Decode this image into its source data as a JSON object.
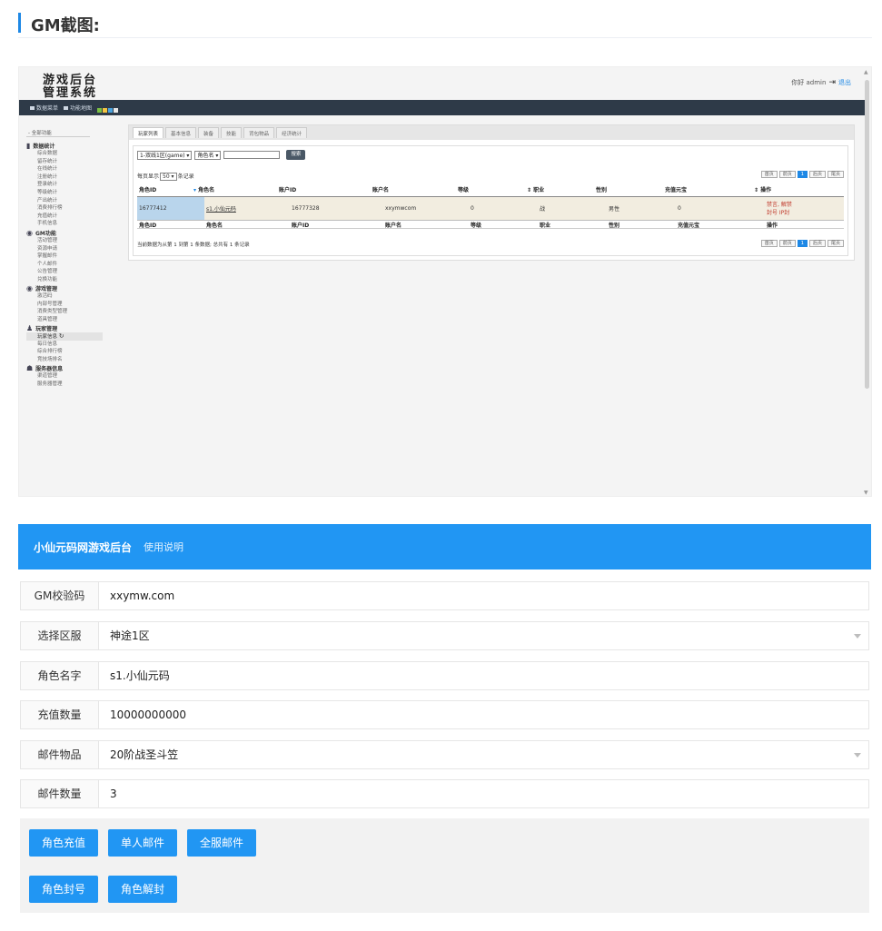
{
  "section": {
    "title": "GM截图:"
  },
  "screenshot": {
    "logo_line1": "游戏后台",
    "logo_line2": "管理系统",
    "user_greeting": "你好 admin",
    "exit_label": "退出",
    "nav_items": [
      "数据菜单",
      "功能地图"
    ],
    "nav_colors": [
      "#7bc043",
      "#f4c542",
      "#4aa3df",
      "#e8e8e8"
    ],
    "sidebar_all": "- 全部功能",
    "sidebar_groups": [
      {
        "title": "数据统计",
        "icon": "bar-chart-icon",
        "items": [
          "综合数据",
          "留存统计",
          "在线统计",
          "注册统计",
          "登录统计",
          "等级统计",
          "产出统计",
          "消费排行榜",
          "充值统计",
          "手机信息"
        ]
      },
      {
        "title": "GM功能",
        "icon": "tag-icon",
        "items": [
          "活动管理",
          "资源申请",
          "掌握邮件",
          "个人邮件",
          "公告管理",
          "兑换功能"
        ]
      },
      {
        "title": "游戏管理",
        "icon": "tag-icon",
        "items": [
          "激活码",
          "内部号管理",
          "消费类型管理",
          "道具管理"
        ]
      },
      {
        "title": "玩家管理",
        "icon": "user-icon",
        "items": [
          "玩家信息",
          "每日信息",
          "综合排行榜",
          "竞技场排名"
        ]
      },
      {
        "title": "服务器信息",
        "icon": "server-icon",
        "items": [
          "渠道管理",
          "服务器管理"
        ]
      }
    ],
    "tabs": [
      "玩家列表",
      "基本信息",
      "装备",
      "技能",
      "背包物品",
      "经济统计"
    ],
    "server_select": "1-双线1区(game) ▾",
    "field_select": "角色名 ▾",
    "search_label": "搜索",
    "perpage_prefix": "每页显示",
    "perpage_value": "50 ▾",
    "perpage_suffix": "条记录",
    "pager": [
      "首页",
      "前页",
      "1",
      "后页",
      "尾页"
    ],
    "columns": [
      "角色ID",
      "角色名",
      "账户ID",
      "账户名",
      "等级",
      "职业",
      "性别",
      "充值元宝",
      "操作"
    ],
    "row": {
      "role_id": "16777412",
      "role_name": "s1.小仙元码",
      "account_id": "16777328",
      "account_name": "xxymwcom",
      "level": "0",
      "job": "战",
      "gender": "男性",
      "gold": "0",
      "ops_line1": "禁言, 解禁",
      "ops_line2": "封号 IP封"
    },
    "info_text": "当前数据为从第 1 到第 1 条数据; 总共有 1 条记录"
  },
  "form": {
    "brand": "小仙元码网游戏后台",
    "usage": "使用说明",
    "fields": [
      {
        "label": "GM校验码",
        "value": "xxymw.com"
      },
      {
        "label": "选择区服",
        "value": "神途1区"
      },
      {
        "label": "角色名字",
        "value": "s1.小仙元码"
      },
      {
        "label": "充值数量",
        "value": "10000000000"
      },
      {
        "label": "邮件物品",
        "value": "20阶战圣斗笠"
      },
      {
        "label": "邮件数量",
        "value": "3"
      }
    ],
    "buttons": [
      "角色充值",
      "单人邮件",
      "全服邮件",
      "角色封号",
      "角色解封"
    ]
  }
}
